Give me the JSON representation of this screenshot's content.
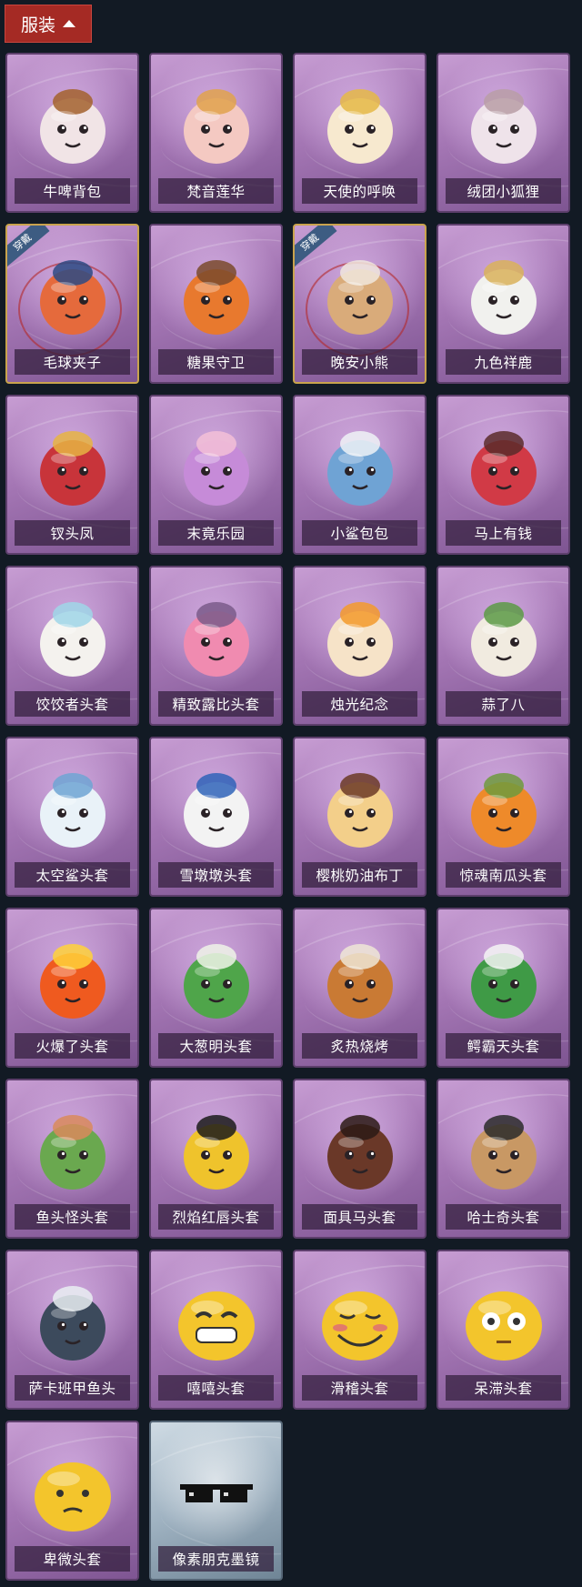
{
  "header": {
    "title": "服装"
  },
  "colors": {
    "header_bg": "#a52a24",
    "card_purple": "#a476b4",
    "equipped_border": "#c9a34d"
  },
  "items": [
    {
      "name": "牛啤背包",
      "icon": "cow-beer-barrel-icon",
      "equipped": false,
      "tag": "",
      "color": "#f1e4e6",
      "accent": "#a3612d"
    },
    {
      "name": "梵音莲华",
      "icon": "lotus-girl-figure-icon",
      "equipped": false,
      "tag": "",
      "color": "#f4c9c2",
      "accent": "#e0a24c"
    },
    {
      "name": "天使的呼唤",
      "icon": "angel-figure-icon",
      "equipped": false,
      "tag": "",
      "color": "#f7e9cf",
      "accent": "#e5b946"
    },
    {
      "name": "绒团小狐狸",
      "icon": "fox-charm-icon",
      "equipped": false,
      "tag": "",
      "color": "#efe3ea",
      "accent": "#b89da6"
    },
    {
      "name": "毛球夹子",
      "icon": "raccoon-hairclip-icon",
      "equipped": true,
      "tag": "穿戴",
      "color": "#e56a3c",
      "accent": "#2d4a84"
    },
    {
      "name": "糖果守卫",
      "icon": "pumpkin-guard-icon",
      "equipped": false,
      "tag": "",
      "color": "#e8792e",
      "accent": "#7a4a2c"
    },
    {
      "name": "晚安小熊",
      "icon": "teddy-bear-icon",
      "equipped": true,
      "tag": "穿戴",
      "color": "#d9ab7a",
      "accent": "#f0e6dd"
    },
    {
      "name": "九色祥鹿",
      "icon": "deer-charm-icon",
      "equipped": false,
      "tag": "",
      "color": "#f1f1ee",
      "accent": "#d9b25b"
    },
    {
      "name": "钗头凤",
      "icon": "phoenix-crown-girl-icon",
      "equipped": false,
      "tag": "",
      "color": "#c8343a",
      "accent": "#e6b443"
    },
    {
      "name": "末竟乐园",
      "icon": "paradise-girl-icon",
      "equipped": false,
      "tag": "",
      "color": "#c68bd8",
      "accent": "#f3c0d7"
    },
    {
      "name": "小鲨包包",
      "icon": "shark-bag-icon",
      "equipped": false,
      "tag": "",
      "color": "#6fa3d4",
      "accent": "#eef2f6"
    },
    {
      "name": "马上有钱",
      "icon": "red-horse-icon",
      "equipped": false,
      "tag": "",
      "color": "#d13a46",
      "accent": "#5b2b2a"
    },
    {
      "name": "饺饺者头套",
      "icon": "dumpling-mask-icon",
      "equipped": false,
      "tag": "",
      "color": "#f4f2ee",
      "accent": "#9fd6e8"
    },
    {
      "name": "精致露比头套",
      "icon": "pink-beaver-mask-icon",
      "equipped": false,
      "tag": "",
      "color": "#f08bb0",
      "accent": "#7a5a8a"
    },
    {
      "name": "烛光纪念",
      "icon": "candle-mask-icon",
      "equipped": false,
      "tag": "",
      "color": "#f6e3c8",
      "accent": "#f39a2b"
    },
    {
      "name": "蒜了八",
      "icon": "garlic-mask-icon",
      "equipped": false,
      "tag": "",
      "color": "#f1ebe0",
      "accent": "#5c9a45"
    },
    {
      "name": "太空鲨头套",
      "icon": "space-shark-mask-icon",
      "equipped": false,
      "tag": "",
      "color": "#e9f2f8",
      "accent": "#6fa4d3"
    },
    {
      "name": "雪墩墩头套",
      "icon": "snowman-mask-icon",
      "equipped": false,
      "tag": "",
      "color": "#f3f3f3",
      "accent": "#2f63b8"
    },
    {
      "name": "樱桃奶油布丁",
      "icon": "pudding-mask-icon",
      "equipped": false,
      "tag": "",
      "color": "#f3cf8a",
      "accent": "#6b3a26"
    },
    {
      "name": "惊魂南瓜头套",
      "icon": "pumpkin-mask-icon",
      "equipped": false,
      "tag": "",
      "color": "#ee8a2a",
      "accent": "#6e9a3d"
    },
    {
      "name": "火爆了头套",
      "icon": "fire-mask-icon",
      "equipped": false,
      "tag": "",
      "color": "#ef5a1f",
      "accent": "#ffd23a"
    },
    {
      "name": "大葱明头套",
      "icon": "scallion-mask-icon",
      "equipped": false,
      "tag": "",
      "color": "#4fa54a",
      "accent": "#eef3e8"
    },
    {
      "name": "炙热烧烤",
      "icon": "bbq-mask-icon",
      "equipped": false,
      "tag": "",
      "color": "#c97a34",
      "accent": "#efe6d6"
    },
    {
      "name": "鳄霸天头套",
      "icon": "crocodile-mask-icon",
      "equipped": false,
      "tag": "",
      "color": "#3f9a46",
      "accent": "#f4f4f4"
    },
    {
      "name": "鱼头怪头套",
      "icon": "fish-head-mask-icon",
      "equipped": false,
      "tag": "",
      "color": "#6aa84f",
      "accent": "#d98a5c"
    },
    {
      "name": "烈焰红唇头套",
      "icon": "yellow-mask-sunglasses-icon",
      "equipped": false,
      "tag": "",
      "color": "#efc32c",
      "accent": "#1b1b1b"
    },
    {
      "name": "面具马头套",
      "icon": "horse-mask-icon",
      "equipped": false,
      "tag": "",
      "color": "#6a3828",
      "accent": "#2b1a15"
    },
    {
      "name": "哈士奇头套",
      "icon": "husky-mask-icon",
      "equipped": false,
      "tag": "",
      "color": "#c89864",
      "accent": "#2a2a2a"
    },
    {
      "name": "萨卡班甲鱼头",
      "icon": "fish-mask-icon",
      "equipped": false,
      "tag": "",
      "color": "#3c4a5c",
      "accent": "#e9eef2"
    },
    {
      "name": "嘻嘻头套",
      "icon": "grin-emoji-mask-icon",
      "equipped": false,
      "tag": "",
      "color": "#f3c52c",
      "accent": "#1b1b1b"
    },
    {
      "name": "滑稽头套",
      "icon": "smirk-emoji-mask-icon",
      "equipped": false,
      "tag": "",
      "color": "#f3c52c",
      "accent": "#e27a6a"
    },
    {
      "name": "呆滞头套",
      "icon": "dazed-emoji-mask-icon",
      "equipped": false,
      "tag": "",
      "color": "#f3c52c",
      "accent": "#ffffff"
    },
    {
      "name": "卑微头套",
      "icon": "humble-emoji-mask-icon",
      "equipped": false,
      "tag": "",
      "color": "#f3c52c",
      "accent": "#1b1b1b"
    },
    {
      "name": "像素朋克墨镜",
      "icon": "pixel-sunglasses-icon",
      "equipped": false,
      "tag": "",
      "color": "#111111",
      "accent": "#444444",
      "special": true
    }
  ]
}
